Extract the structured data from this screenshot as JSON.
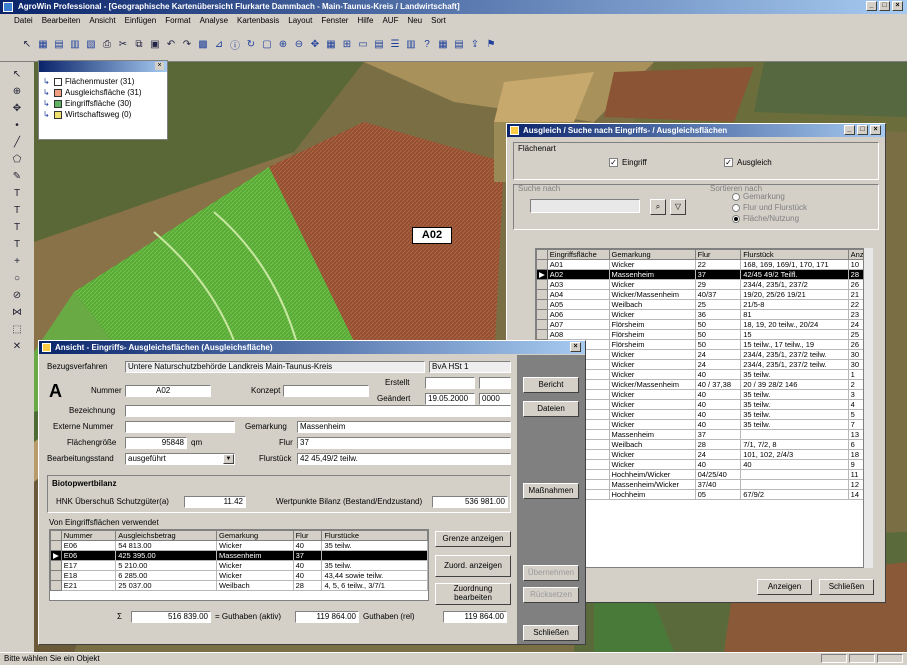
{
  "app": {
    "title": "AgroWin Professional - [Geographische Kartenübersicht Flurkarte Dammbach - Main-Taunus-Kreis / Landwirtschaft]",
    "menu": [
      "Datei",
      "Bearbeiten",
      "Ansicht",
      "Einfügen",
      "Format",
      "Analyse",
      "Kartenbasis",
      "Layout",
      "Fenster",
      "Hilfe",
      "AUF",
      "Neu",
      "Sort"
    ],
    "status": "Bitte wählen Sie ein Objekt"
  },
  "legend": {
    "items": [
      {
        "label": "Flächenmuster (31)",
        "color": "#ffffff"
      },
      {
        "label": "Ausgleichsfläche (31)",
        "color": "#f0a080"
      },
      {
        "label": "Eingriffsfläche (30)",
        "color": "#60b060"
      },
      {
        "label": "Wirtschaftsweg (0)",
        "color": "#f0e070"
      }
    ]
  },
  "map": {
    "marker_label": "A02"
  },
  "search_dialog": {
    "title": "Ausgleich / Suche nach Eingriffs- / Ausgleichsflächen",
    "group_label": "Flächenart",
    "eingriff_label": "Eingriff",
    "ausgleich_label": "Ausgleich",
    "search_group_label": "Suche nach",
    "sort_group_label": "Sortieren nach",
    "radios": [
      "Gemarkung",
      "Flur und Flurstück",
      "Fläche/Nutzung"
    ],
    "columns": [
      "Eingriffsfläche",
      "Gemarkung",
      "Flur",
      "Flurstück",
      "Anz"
    ],
    "rows": [
      [
        "A01",
        "Wicker",
        "22",
        "168, 169, 169/1, 170, 171",
        "10"
      ],
      [
        "A02",
        "Massenheim",
        "37",
        "42/45 49/2 Teilfl.",
        "28"
      ],
      [
        "A03",
        "Wicker",
        "29",
        "234/4, 235/1, 237/2",
        "26"
      ],
      [
        "A04",
        "Wicker/Massenheim",
        "40/37",
        "19/20, 25/26 19/21",
        "21"
      ],
      [
        "A05",
        "Weilbach",
        "25",
        "21/5-8",
        "22"
      ],
      [
        "A06",
        "Wicker",
        "36",
        "81",
        "23"
      ],
      [
        "A07",
        "Flörsheim",
        "50",
        "18, 19, 20 teilw., 20/24",
        "24"
      ],
      [
        "A08",
        "Flörsheim",
        "50",
        "15",
        "25"
      ],
      [
        "A09",
        "Flörsheim",
        "50",
        "15 teilw., 17 teilw., 19",
        "26"
      ],
      [
        "A10",
        "Wicker",
        "24",
        "234/4, 235/1, 237/2 teilw.",
        "30"
      ],
      [
        "A11",
        "Wicker",
        "24",
        "234/4, 235/1, 237/2 teilw.",
        "30"
      ],
      [
        "A12",
        "Wicker",
        "40",
        "35 teilw.",
        "1"
      ],
      [
        "A13",
        "Wicker/Massenheim",
        "40 / 37,38",
        "20 / 39 28/2 146",
        "2"
      ],
      [
        "A14",
        "Wicker",
        "40",
        "35 teilw.",
        "3"
      ],
      [
        "A15",
        "Wicker",
        "40",
        "35 teilw.",
        "4"
      ],
      [
        "A16",
        "Wicker",
        "40",
        "35 teilw.",
        "5"
      ],
      [
        "A17",
        "Wicker",
        "40",
        "35 teilw.",
        "7"
      ],
      [
        "A18",
        "Massenheim",
        "37",
        "",
        "13"
      ],
      [
        "A19",
        "Weilbach",
        "28",
        "7/1, 7/2, 8",
        "6"
      ],
      [
        "A20",
        "Wicker",
        "24",
        "101, 102, 2/4/3",
        "18"
      ],
      [
        "A21",
        "Wicker",
        "40",
        "40",
        "9"
      ],
      [
        "A22",
        "Hochheim/Wicker",
        "04/25/40",
        "",
        "11"
      ],
      [
        "A23",
        "Massenheim/Wicker",
        "37/40",
        "",
        "12"
      ],
      [
        "A24",
        "Hochheim",
        "05",
        "67/9/2",
        "14"
      ]
    ],
    "anzeigen_label": "Anzeigen",
    "schliessen_label": "Schließen"
  },
  "detail_dialog": {
    "title": "Ansicht - Eingriffs- Ausgleichsflächen (Ausgleichsfläche)",
    "bezugsverfahren_label": "Bezugsverfahren",
    "bezugsverfahren_value": "Untere Naturschutzbehörde Landkreis Main-Taunus-Kreis",
    "kreis_value": "BvA HSt 1",
    "type_letter": "A",
    "nummer_label": "Nummer",
    "nummer_value": "A02",
    "konzept_label": "Konzept",
    "erstellt_label": "Erstellt",
    "geaendert_label": "Geändert",
    "geaendert_value": "19.05.2000",
    "geaendert_extra": "0000",
    "bezeichnung_label": "Bezeichnung",
    "externe_nummer_label": "Externe Nummer",
    "gemarkung_label": "Gemarkung",
    "gemarkung_value": "Massenheim",
    "flaeche_label": "Flächengröße",
    "flaeche_value": "95848",
    "flaeche_unit": "qm",
    "flur_label": "Flur",
    "flur_value": "37",
    "bearbeitung_label": "Bearbeitungsstand",
    "bearbeitung_value": "ausgeführt",
    "flurstueck_label": "Flurstück",
    "flurstueck_value": "42 45,49/2 teilw.",
    "bio_header": "Biotopwertbilanz",
    "bio_label1": "HNK Überschuß Schutzgüter(a)",
    "bio_value1": "11.42",
    "bio_label2": "Wertpunkte Bilanz (Bestand/Endzustand)",
    "bio_value2": "536 981.00",
    "table_header": "Von Eingriffsflächen verwendet",
    "columns": [
      "Nummer",
      "Ausgleichsbetrag",
      "Gemarkung",
      "Flur",
      "Flurstücke"
    ],
    "rows": [
      [
        "E06",
        "54 813.00",
        "Wicker",
        "40",
        "35 teilw."
      ],
      [
        "E06",
        "425 395.00",
        "Massenheim",
        "37",
        ""
      ],
      [
        "E17",
        "5 210.00",
        "Wicker",
        "40",
        "35 teilw."
      ],
      [
        "E18",
        "6 285.00",
        "Wicker",
        "40",
        "43,44 sowie teilw."
      ],
      [
        "E21",
        "25 037.00",
        "Weilbach",
        "28",
        "4, 5, 6 teilw., 3/7/1"
      ]
    ],
    "sum_label": "Σ",
    "sum_value": "516 839.00",
    "guthaben_label": "= Guthaben (aktiv)",
    "guthaben_value": "119 864.00",
    "guthaben2_label": "Guthaben (rel)",
    "guthaben2_value": "119 864.00",
    "btn_bericht": "Bericht",
    "btn_dateien": "Dateien",
    "btn_massnahmen": "Maßnahmen",
    "btn_eingriff_anzeigen": "Grenze anzeigen",
    "btn_zuord_anzeigen": "Zuord. anzeigen",
    "btn_zuordnung_bearb": "Zuordnung bearbeiten",
    "btn_uebernehmen": "Übernehmen",
    "btn_ruecksetzen": "Rücksetzen",
    "btn_schliessen": "Schließen"
  }
}
